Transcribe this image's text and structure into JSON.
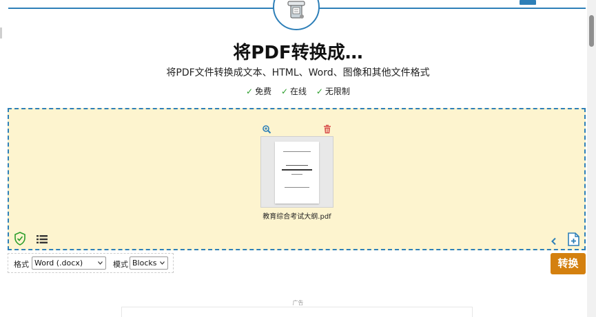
{
  "header": {
    "title": "将PDF转换成…",
    "subtitle": "将PDF文件转换成文本、HTML、Word、图像和其他文件格式",
    "features": [
      "免费",
      "在线",
      "无限制"
    ],
    "check_glyph": "✓"
  },
  "file": {
    "name": "教育综合考试大纲.pdf"
  },
  "options": {
    "format_label": "格式",
    "format_value": "Word (.docx)",
    "mode_label": "模式",
    "mode_value": "Blocks"
  },
  "actions": {
    "convert_label": "转换"
  },
  "ad": {
    "label": "广告"
  },
  "colors": {
    "accent": "#2d7fb8",
    "dropzone_bg": "#fdf4cf",
    "convert_button": "#d4800f",
    "check": "#2a9d2a",
    "trash": "#d9534f",
    "shield": "#2a9d2a"
  },
  "icons": [
    "mascot-icon",
    "zoom-in-icon",
    "trash-icon",
    "shield-check-icon",
    "list-icon",
    "chevron-left-icon",
    "add-file-icon"
  ]
}
